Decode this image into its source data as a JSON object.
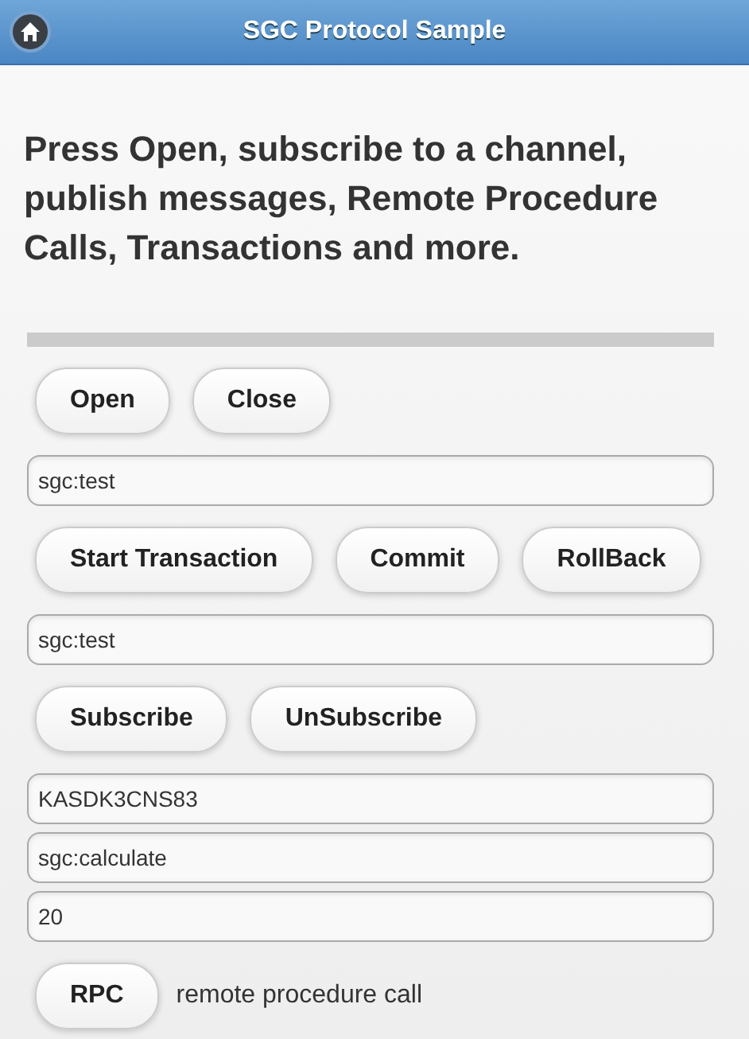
{
  "header": {
    "title": "SGC Protocol Sample"
  },
  "intro": "Press Open, subscribe to a channel, publish messages, Remote Procedure Calls, Transactions and more.",
  "sections": [
    {
      "kind": "buttons",
      "buttons": [
        "Open",
        "Close"
      ]
    },
    {
      "kind": "input",
      "value": "sgc:test"
    },
    {
      "kind": "buttons",
      "buttons": [
        "Start Transaction",
        "Commit",
        "RollBack"
      ]
    },
    {
      "kind": "input",
      "value": "sgc:test"
    },
    {
      "kind": "buttons",
      "buttons": [
        "Subscribe",
        "UnSubscribe"
      ]
    },
    {
      "kind": "input",
      "value": "KASDK3CNS83"
    },
    {
      "kind": "input",
      "value": "sgc:calculate"
    },
    {
      "kind": "input",
      "value": "20"
    },
    {
      "kind": "buttons",
      "buttons": [
        "RPC"
      ],
      "note": "remote procedure call"
    }
  ]
}
